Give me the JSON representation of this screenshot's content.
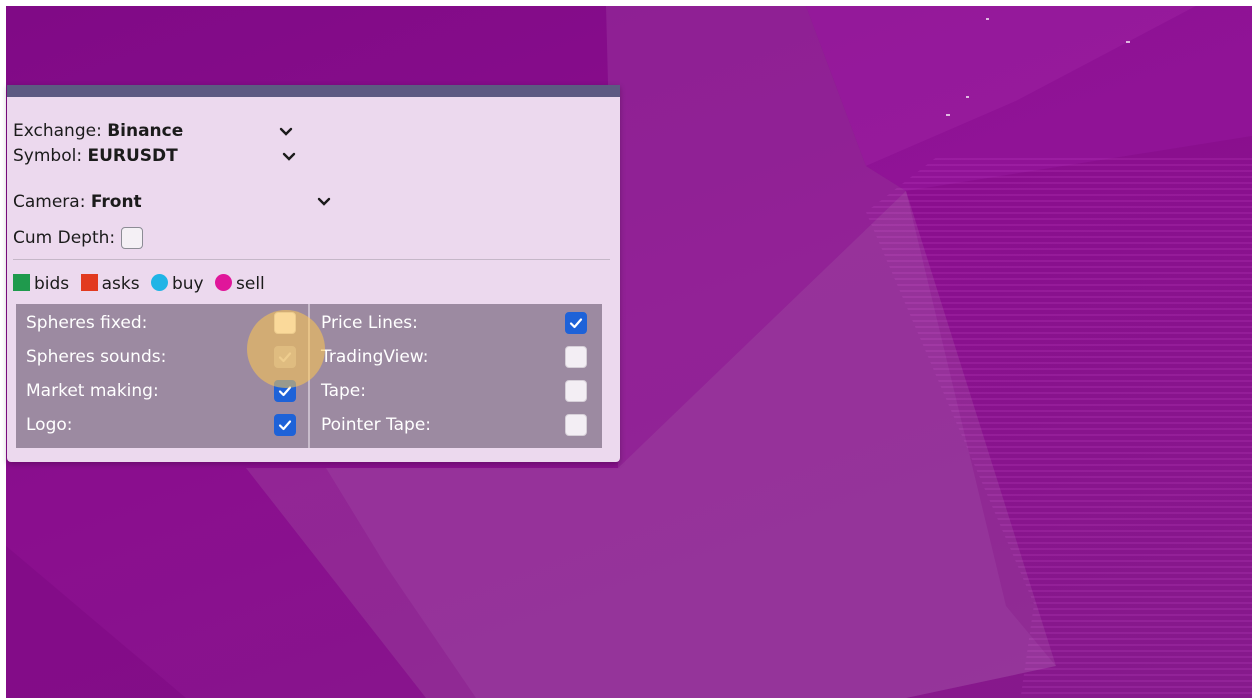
{
  "panel": {
    "exchange": {
      "label": "Exchange:",
      "value": "Binance"
    },
    "symbol": {
      "label": "Symbol:",
      "value": "EURUSDT"
    },
    "camera": {
      "label": "Camera:",
      "value": "Front"
    },
    "cum_depth": {
      "label": "Cum Depth:",
      "checked": false
    }
  },
  "legend": [
    {
      "label": "bids",
      "color": "#1f9a4d",
      "shape": "square"
    },
    {
      "label": "asks",
      "color": "#e23a1f",
      "shape": "square"
    },
    {
      "label": "buy",
      "color": "#1fb4e6",
      "shape": "circle"
    },
    {
      "label": "sell",
      "color": "#e0169a",
      "shape": "circle"
    }
  ],
  "options": {
    "left": [
      {
        "label": "Spheres fixed:",
        "checked": false
      },
      {
        "label": "Spheres sounds:",
        "checked": true
      },
      {
        "label": "Market making:",
        "checked": true
      },
      {
        "label": "Logo:",
        "checked": true
      }
    ],
    "right": [
      {
        "label": "Price Lines:",
        "checked": true
      },
      {
        "label": "TradingView:",
        "checked": false
      },
      {
        "label": "Tape:",
        "checked": false
      },
      {
        "label": "Pointer Tape:",
        "checked": false
      }
    ]
  },
  "colors": {
    "accent_checkbox": "#1e62d8",
    "click_highlight": "#ffc850"
  }
}
